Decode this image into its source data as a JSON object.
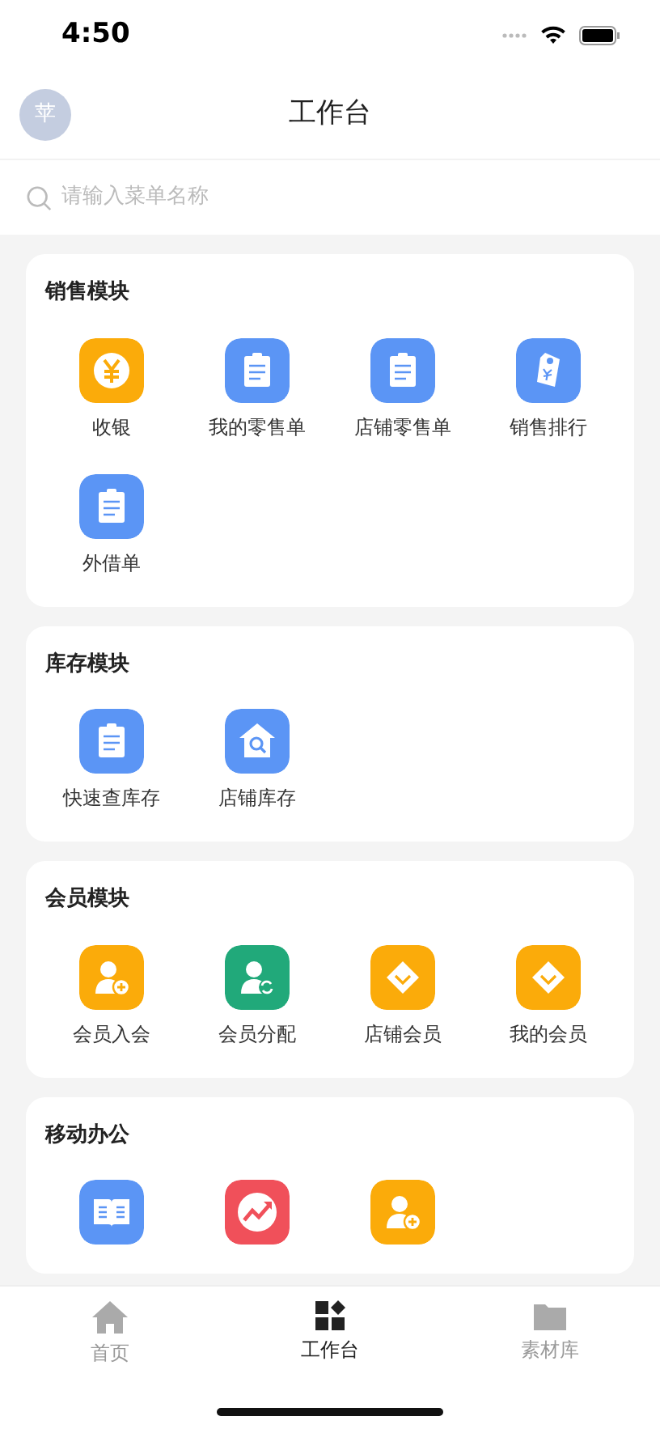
{
  "status_bar": {
    "time": "4:50"
  },
  "header": {
    "avatar": "苹",
    "title": "工作台"
  },
  "search": {
    "placeholder": "请输入菜单名称"
  },
  "sections": [
    {
      "title": "销售模块",
      "items": [
        {
          "label": "收银",
          "kind": "yen",
          "color": "#fbab0a"
        },
        {
          "label": "我的零售单",
          "kind": "clipboard",
          "color": "#5b95f5"
        },
        {
          "label": "店铺零售单",
          "kind": "clipboard",
          "color": "#5b95f5"
        },
        {
          "label": "销售排行",
          "kind": "tag",
          "color": "#5b95f5"
        },
        {
          "label": "外借单",
          "kind": "clipboard",
          "color": "#5b95f5"
        }
      ]
    },
    {
      "title": "库存模块",
      "items": [
        {
          "label": "快速查库存",
          "kind": "clipboard",
          "color": "#5b95f5"
        },
        {
          "label": "店铺库存",
          "kind": "house",
          "color": "#5b95f5"
        }
      ]
    },
    {
      "title": "会员模块",
      "items": [
        {
          "label": "会员入会",
          "kind": "useradd",
          "color": "#fbab0a"
        },
        {
          "label": "会员分配",
          "kind": "userswap",
          "color": "#21a97a"
        },
        {
          "label": "店铺会员",
          "kind": "diamond",
          "color": "#fbab0a"
        },
        {
          "label": "我的会员",
          "kind": "diamond",
          "color": "#fbab0a"
        }
      ]
    },
    {
      "title": "移动办公",
      "items": [
        {
          "kind": "book",
          "color": "#5b95f5"
        },
        {
          "kind": "chart",
          "color": "#f0505a"
        },
        {
          "kind": "useradd",
          "color": "#fbab0a"
        }
      ]
    }
  ],
  "tab_bar": [
    {
      "label": "首页",
      "kind": "home",
      "selected": false
    },
    {
      "label": "工作台",
      "kind": "grid",
      "selected": true
    },
    {
      "label": "素材库",
      "kind": "folder",
      "selected": false
    }
  ]
}
